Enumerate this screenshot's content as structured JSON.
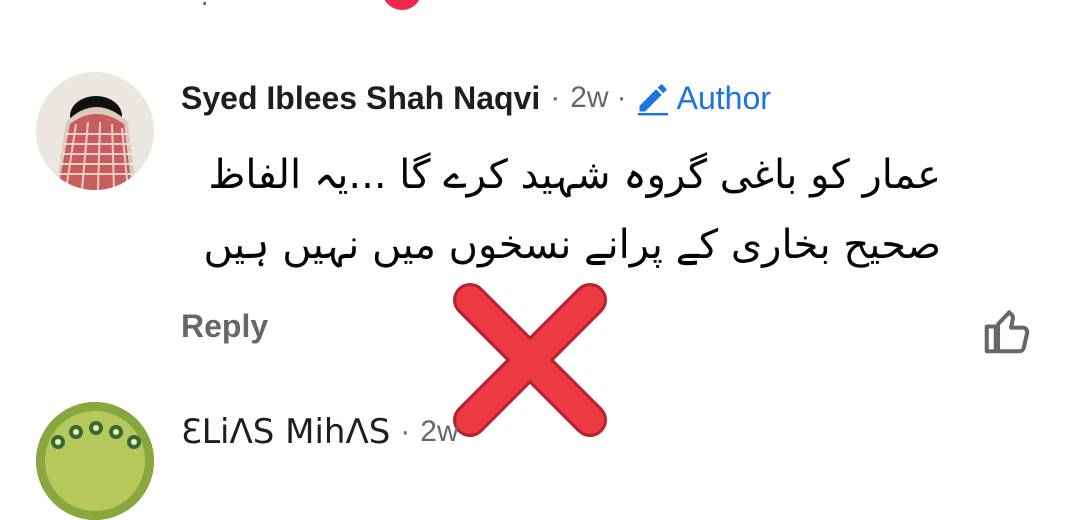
{
  "comment": {
    "author": "Syed Iblees Shah Naqvi",
    "time": "2w",
    "separator": "·",
    "author_badge": "Author",
    "text_lines": [
      "عمار کو باغی گروہ شہید کرے گا ...یہ الفاظ",
      "صحیح بخاری کے پرانے نسخوں میں نہیں ہیں"
    ],
    "reply_label": "Reply",
    "like_icon": "thumbs-up-icon",
    "edit_icon": "pencil-icon"
  },
  "next_comment": {
    "author": "ƐԼiɅS MihɅS",
    "separator": "·",
    "time": "2w"
  },
  "overlay": {
    "mark": "red-x-cross",
    "color": "#e8313b"
  },
  "colors": {
    "link_blue": "#1b74e4",
    "muted_gray": "#65676b",
    "notification_red": "#f02849"
  }
}
